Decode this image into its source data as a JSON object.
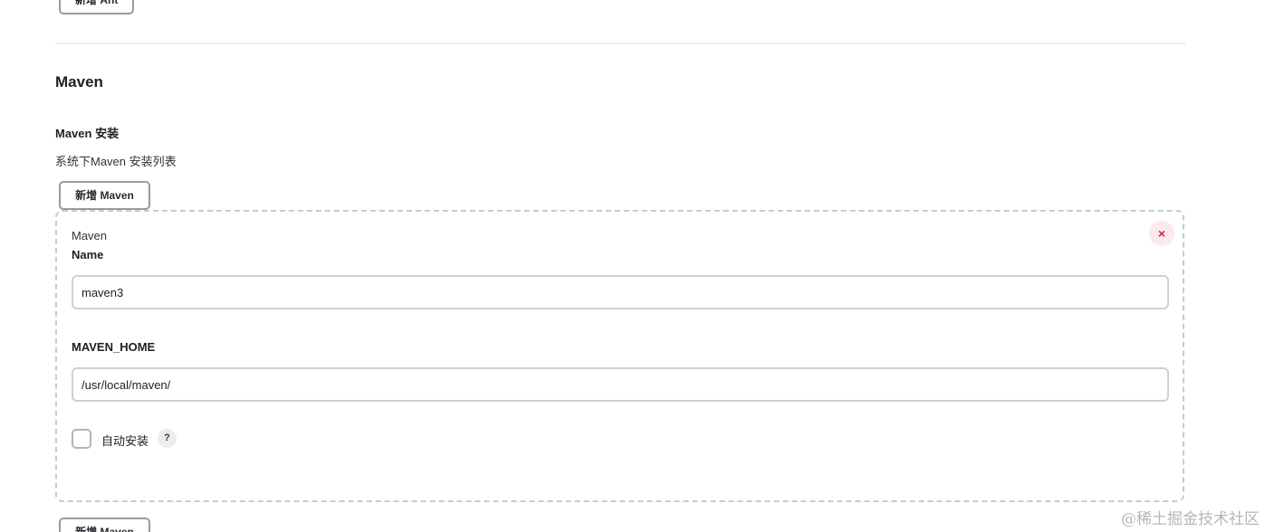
{
  "ant": {
    "add_button_label": "新增 Ant"
  },
  "maven": {
    "section_title": "Maven",
    "install_label": "Maven 安装",
    "install_description": "系统下Maven 安装列表",
    "add_button_label": "新增 Maven",
    "item": {
      "header": "Maven",
      "delete_icon": "×",
      "name_label": "Name",
      "name_value": "maven3",
      "home_label": "MAVEN_HOME",
      "home_value": "/usr/local/maven/",
      "auto_install_label": "自动安装",
      "auto_install_checked": false,
      "help_icon": "?"
    }
  },
  "watermark": "@稀土掘金技术社区",
  "colors": {
    "delete_icon": "#d4203d",
    "delete_icon_bg": "#fde8ec",
    "border": "#9a9aa0"
  }
}
